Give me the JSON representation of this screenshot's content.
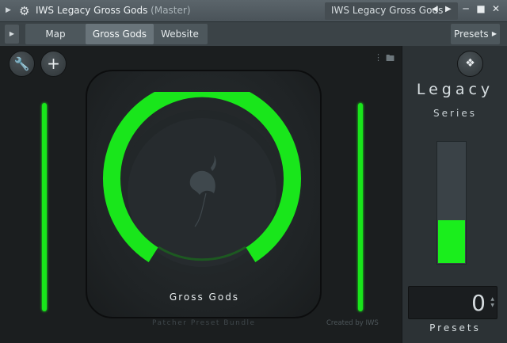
{
  "titlebar": {
    "title": "IWS Legacy Gross Gods",
    "subtitle": "(Master)",
    "preset_name": "IWS Legacy Gross Gods",
    "icons": {
      "collapse": "triangle-right-icon",
      "settings": "gear-icon",
      "prev": "triangle-left-icon",
      "next": "triangle-right-icon",
      "minimize": "minimize-icon",
      "maximize": "maximize-icon",
      "close": "close-icon"
    }
  },
  "tabs": {
    "items": [
      "Map",
      "Gross Gods",
      "Website"
    ],
    "active": "Gross Gods",
    "presets_label": "Presets"
  },
  "main": {
    "plugin_name": "Gross Gods",
    "footer_left": "Patcher Preset Bundle",
    "footer_right": "Created by IWS",
    "knob_color": "#19e61b",
    "icons": {
      "wrench": "wrench-icon",
      "add": "plus-icon",
      "menu": "vertical-dots-icon",
      "folder": "folder-icon",
      "bird": "bird-icon",
      "logo": "fruit-logo-icon"
    }
  },
  "right_panel": {
    "title": "Legacy",
    "subtitle": "Series",
    "meter_level": 0.35,
    "meter_color": "#1aee1c",
    "counter_value": "0",
    "counter_label": "Presets"
  }
}
